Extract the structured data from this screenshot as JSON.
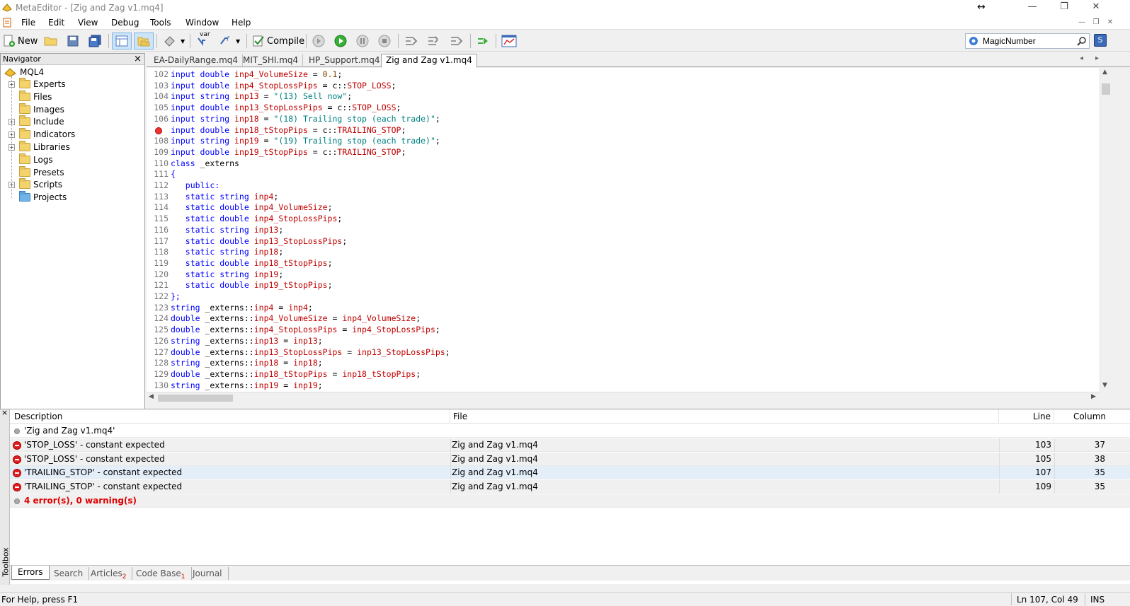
{
  "window": {
    "title": "MetaEditor - [Zig and Zag v1.mq4]",
    "min_label": "—",
    "restore_label": "❐",
    "close_label": "✕",
    "resize_cursor": "↔"
  },
  "menu": [
    "File",
    "Edit",
    "View",
    "Debug",
    "Tools",
    "Window",
    "Help"
  ],
  "toolbar": {
    "new_label": "New",
    "compile_label": "Compile",
    "var_label": "var",
    "search_value": "MagicNumber"
  },
  "navigator": {
    "header": "Navigator",
    "close": "×",
    "root": "MQL4",
    "items": [
      {
        "label": "Experts",
        "expandable": true
      },
      {
        "label": "Files",
        "expandable": false
      },
      {
        "label": "Images",
        "expandable": false
      },
      {
        "label": "Include",
        "expandable": true
      },
      {
        "label": "Indicators",
        "expandable": true
      },
      {
        "label": "Libraries",
        "expandable": true
      },
      {
        "label": "Logs",
        "expandable": false
      },
      {
        "label": "Presets",
        "expandable": false
      },
      {
        "label": "Scripts",
        "expandable": true
      },
      {
        "label": "Projects",
        "expandable": false
      }
    ]
  },
  "tabs": [
    "EA-DailyRange.mq4",
    "MIT_SHI.mq4",
    "HP_Support.mq4",
    "Zig and Zag v1.mq4"
  ],
  "code_lines": [
    {
      "n": "102",
      "tokens": [
        [
          "kw",
          "input double "
        ],
        [
          "id",
          "inp4_VolumeSize"
        ],
        [
          "plain",
          " = "
        ],
        [
          "num",
          "0.1"
        ],
        [
          "plain",
          ";"
        ]
      ]
    },
    {
      "n": "103",
      "tokens": [
        [
          "kw",
          "input double "
        ],
        [
          "id",
          "inp4_StopLossPips"
        ],
        [
          "plain",
          " = c::"
        ],
        [
          "id",
          "STOP_LOSS"
        ],
        [
          "plain",
          ";"
        ]
      ]
    },
    {
      "n": "104",
      "tokens": [
        [
          "kw",
          "input string "
        ],
        [
          "id",
          "inp13"
        ],
        [
          "plain",
          " = "
        ],
        [
          "str",
          "\"(13) Sell now\""
        ],
        [
          "plain",
          ";"
        ]
      ]
    },
    {
      "n": "105",
      "tokens": [
        [
          "kw",
          "input double "
        ],
        [
          "id",
          "inp13_StopLossPips"
        ],
        [
          "plain",
          " = c::"
        ],
        [
          "id",
          "STOP_LOSS"
        ],
        [
          "plain",
          ";"
        ]
      ]
    },
    {
      "n": "106",
      "tokens": [
        [
          "kw",
          "input string "
        ],
        [
          "id",
          "inp18"
        ],
        [
          "plain",
          " = "
        ],
        [
          "str",
          "\"(18) Trailing stop (each trade)\""
        ],
        [
          "plain",
          ";"
        ]
      ]
    },
    {
      "n": "107",
      "bp": true,
      "tokens": [
        [
          "kw",
          "input double "
        ],
        [
          "id",
          "inp18_tStopPips"
        ],
        [
          "plain",
          " = c::"
        ],
        [
          "id",
          "TRAILING_STOP"
        ],
        [
          "plain",
          ";"
        ]
      ]
    },
    {
      "n": "108",
      "tokens": [
        [
          "kw",
          "input string "
        ],
        [
          "id",
          "inp19"
        ],
        [
          "plain",
          " = "
        ],
        [
          "str",
          "\"(19) Trailing stop (each trade)\""
        ],
        [
          "plain",
          ";"
        ]
      ]
    },
    {
      "n": "109",
      "tokens": [
        [
          "kw",
          "input double "
        ],
        [
          "id",
          "inp19_tStopPips"
        ],
        [
          "plain",
          " = c::"
        ],
        [
          "id",
          "TRAILING_STOP"
        ],
        [
          "plain",
          ";"
        ]
      ]
    },
    {
      "n": "110",
      "tokens": [
        [
          "kw",
          "class "
        ],
        [
          "plain",
          "_externs"
        ]
      ]
    },
    {
      "n": "111",
      "tokens": [
        [
          "kw",
          "{"
        ]
      ]
    },
    {
      "n": "112",
      "tokens": [
        [
          "kw",
          "   public:"
        ]
      ]
    },
    {
      "n": "113",
      "tokens": [
        [
          "kw",
          "   static string "
        ],
        [
          "id",
          "inp4"
        ],
        [
          "plain",
          ";"
        ]
      ]
    },
    {
      "n": "114",
      "tokens": [
        [
          "kw",
          "   static double "
        ],
        [
          "id",
          "inp4_VolumeSize"
        ],
        [
          "plain",
          ";"
        ]
      ]
    },
    {
      "n": "115",
      "tokens": [
        [
          "kw",
          "   static double "
        ],
        [
          "id",
          "inp4_StopLossPips"
        ],
        [
          "plain",
          ";"
        ]
      ]
    },
    {
      "n": "116",
      "tokens": [
        [
          "kw",
          "   static string "
        ],
        [
          "id",
          "inp13"
        ],
        [
          "plain",
          ";"
        ]
      ]
    },
    {
      "n": "117",
      "tokens": [
        [
          "kw",
          "   static double "
        ],
        [
          "id",
          "inp13_StopLossPips"
        ],
        [
          "plain",
          ";"
        ]
      ]
    },
    {
      "n": "118",
      "tokens": [
        [
          "kw",
          "   static string "
        ],
        [
          "id",
          "inp18"
        ],
        [
          "plain",
          ";"
        ]
      ]
    },
    {
      "n": "119",
      "tokens": [
        [
          "kw",
          "   static double "
        ],
        [
          "id",
          "inp18_tStopPips"
        ],
        [
          "plain",
          ";"
        ]
      ]
    },
    {
      "n": "120",
      "tokens": [
        [
          "kw",
          "   static string "
        ],
        [
          "id",
          "inp19"
        ],
        [
          "plain",
          ";"
        ]
      ]
    },
    {
      "n": "121",
      "tokens": [
        [
          "kw",
          "   static double "
        ],
        [
          "id",
          "inp19_tStopPips"
        ],
        [
          "plain",
          ";"
        ]
      ]
    },
    {
      "n": "122",
      "tokens": [
        [
          "kw",
          "};"
        ]
      ]
    },
    {
      "n": "123",
      "tokens": [
        [
          "kw",
          "string "
        ],
        [
          "plain",
          "_externs::"
        ],
        [
          "id",
          "inp4"
        ],
        [
          "plain",
          " = "
        ],
        [
          "id",
          "inp4"
        ],
        [
          "plain",
          ";"
        ]
      ]
    },
    {
      "n": "124",
      "tokens": [
        [
          "kw",
          "double "
        ],
        [
          "plain",
          "_externs::"
        ],
        [
          "id",
          "inp4_VolumeSize"
        ],
        [
          "plain",
          " = "
        ],
        [
          "id",
          "inp4_VolumeSize"
        ],
        [
          "plain",
          ";"
        ]
      ]
    },
    {
      "n": "125",
      "tokens": [
        [
          "kw",
          "double "
        ],
        [
          "plain",
          "_externs::"
        ],
        [
          "id",
          "inp4_StopLossPips"
        ],
        [
          "plain",
          " = "
        ],
        [
          "id",
          "inp4_StopLossPips"
        ],
        [
          "plain",
          ";"
        ]
      ]
    },
    {
      "n": "126",
      "tokens": [
        [
          "kw",
          "string "
        ],
        [
          "plain",
          "_externs::"
        ],
        [
          "id",
          "inp13"
        ],
        [
          "plain",
          " = "
        ],
        [
          "id",
          "inp13"
        ],
        [
          "plain",
          ";"
        ]
      ]
    },
    {
      "n": "127",
      "tokens": [
        [
          "kw",
          "double "
        ],
        [
          "plain",
          "_externs::"
        ],
        [
          "id",
          "inp13_StopLossPips"
        ],
        [
          "plain",
          " = "
        ],
        [
          "id",
          "inp13_StopLossPips"
        ],
        [
          "plain",
          ";"
        ]
      ]
    },
    {
      "n": "128",
      "tokens": [
        [
          "kw",
          "string "
        ],
        [
          "plain",
          "_externs::"
        ],
        [
          "id",
          "inp18"
        ],
        [
          "plain",
          " = "
        ],
        [
          "id",
          "inp18"
        ],
        [
          "plain",
          ";"
        ]
      ]
    },
    {
      "n": "129",
      "tokens": [
        [
          "kw",
          "double "
        ],
        [
          "plain",
          "_externs::"
        ],
        [
          "id",
          "inp18_tStopPips"
        ],
        [
          "plain",
          " = "
        ],
        [
          "id",
          "inp18_tStopPips"
        ],
        [
          "plain",
          ";"
        ]
      ]
    },
    {
      "n": "130",
      "tokens": [
        [
          "kw",
          "string "
        ],
        [
          "plain",
          "_externs::"
        ],
        [
          "id",
          "inp19"
        ],
        [
          "plain",
          " = "
        ],
        [
          "id",
          "inp19"
        ],
        [
          "plain",
          ";"
        ]
      ]
    }
  ],
  "errors": {
    "columns": {
      "description": "Description",
      "file": "File",
      "line": "Line",
      "column": "Column"
    },
    "header_row": "'Zig and Zag v1.mq4'",
    "rows": [
      {
        "description": "'STOP_LOSS' - constant expected",
        "file": "Zig and Zag v1.mq4",
        "line": "103",
        "column": "37"
      },
      {
        "description": "'STOP_LOSS' - constant expected",
        "file": "Zig and Zag v1.mq4",
        "line": "105",
        "column": "38"
      },
      {
        "description": "'TRAILING_STOP' - constant expected",
        "file": "Zig and Zag v1.mq4",
        "line": "107",
        "column": "35"
      },
      {
        "description": "'TRAILING_STOP' - constant expected",
        "file": "Zig and Zag v1.mq4",
        "line": "109",
        "column": "35"
      }
    ],
    "summary": "4 error(s), 0 warning(s)"
  },
  "toolbox": {
    "side_label": "Toolbox",
    "tabs": [
      {
        "label": "Errors",
        "badge": ""
      },
      {
        "label": "Search",
        "badge": ""
      },
      {
        "label": "Articles",
        "badge": "2"
      },
      {
        "label": "Code Base",
        "badge": "1"
      },
      {
        "label": "Journal",
        "badge": ""
      }
    ]
  },
  "status": {
    "help": "For Help, press F1",
    "position": "Ln 107, Col 49",
    "mode": "INS"
  },
  "colors": {
    "keyword": "#0000ff",
    "identifier": "#c00000",
    "string": "#008080",
    "error": "#e02020",
    "summary_text": "#e00000"
  }
}
